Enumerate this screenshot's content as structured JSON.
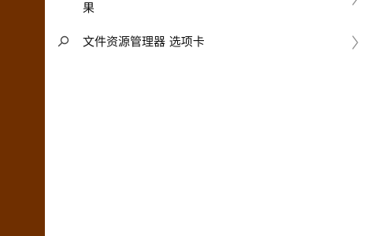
{
  "search_results": {
    "partial_result": {
      "label": "果",
      "chevron_icon": "chevron-right-icon"
    },
    "primary_result": {
      "icon": "search-icon",
      "label": "文件资源管理器 选项卡",
      "chevron_icon": "chevron-right-icon"
    }
  },
  "colors": {
    "left_panel": "#6f2f00",
    "background": "#ffffff",
    "text": "#111111",
    "icon": "#444444",
    "chevron": "#8c8c8c"
  }
}
